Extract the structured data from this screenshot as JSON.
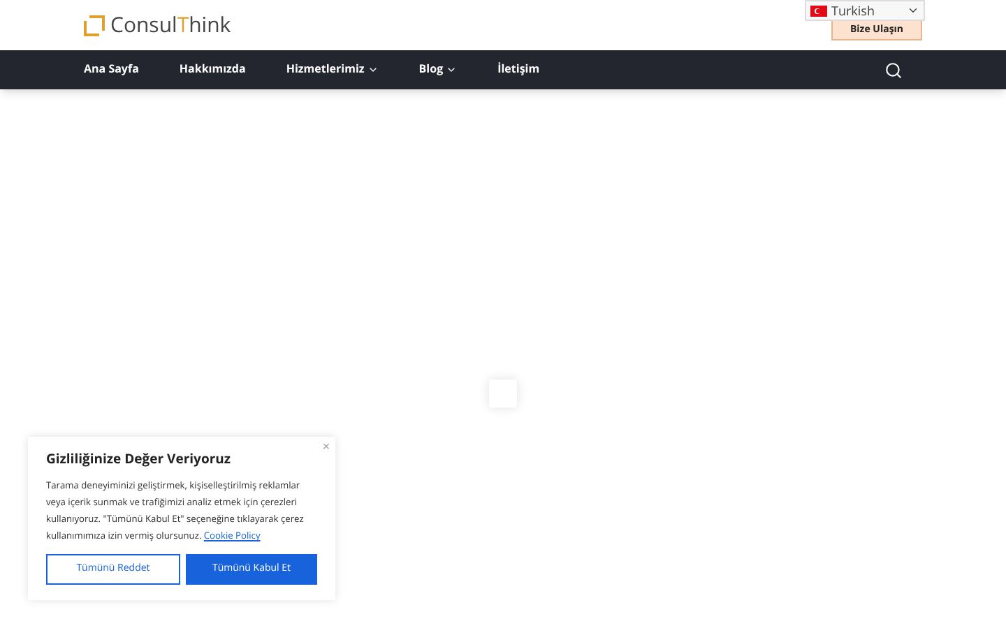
{
  "header": {
    "logo": {
      "parts": [
        "Consul",
        "T",
        "hink"
      ]
    },
    "language": {
      "value": "Turkish"
    },
    "contact_button": "Bize Ulaşın"
  },
  "nav": {
    "items": [
      {
        "label": "Ana Sayfa",
        "has_menu": false
      },
      {
        "label": "Hakkımızda",
        "has_menu": false
      },
      {
        "label": "Hizmetlerimiz",
        "has_menu": true
      },
      {
        "label": "Blog",
        "has_menu": true
      },
      {
        "label": "İletişim",
        "has_menu": false
      }
    ]
  },
  "cookie_banner": {
    "close": "×",
    "title": "Gizliliğinize Değer Veriyoruz",
    "text": "Tarama deneyiminizi geliştirmek, kişiselleştirilmiş reklamlar veya içerik sunmak ve trafiğimizi analiz etmek için çerezleri kullanıyoruz. \"Tümünü Kabul Et\" seçeneğine tıklayarak çerez kullanımımıza izin vermiş olursunuz.",
    "link": "Cookie Policy",
    "buttons": [
      {
        "label": "Tümünü Reddet",
        "kind": "outline"
      },
      {
        "label": "Tümünü Kabul Et",
        "kind": "primary"
      }
    ]
  }
}
